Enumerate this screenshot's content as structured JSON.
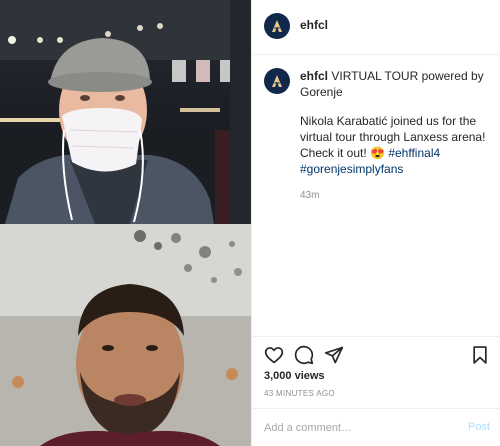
{
  "post": {
    "handle": "ehfcl",
    "caption_handle": "ehfcl",
    "caption_title": " VIRTUAL TOUR powered by Gorenje",
    "caption_body": "Nikola Karabatić joined us for the virtual tour through Lanxess arena! Check it out! ",
    "emoji": "😍",
    "hashtags": [
      "#ehffinal4",
      "#gorenjesimplyfans"
    ],
    "relative_time": "43m"
  },
  "stats": {
    "views": "3,000 views",
    "posted": "43 MINUTES AGO"
  },
  "comment": {
    "placeholder": "Add a comment…",
    "post_label": "Post"
  },
  "icons": {
    "like": "heart-icon",
    "comment": "speech-bubble-icon",
    "share": "paper-plane-icon",
    "save": "bookmark-icon",
    "brand": "ehf-logo-icon"
  },
  "colors": {
    "brand_navy": "#12284a",
    "hashtag": "#00376b",
    "muted": "#8e8e8e",
    "post_button": "#b2dffc"
  }
}
